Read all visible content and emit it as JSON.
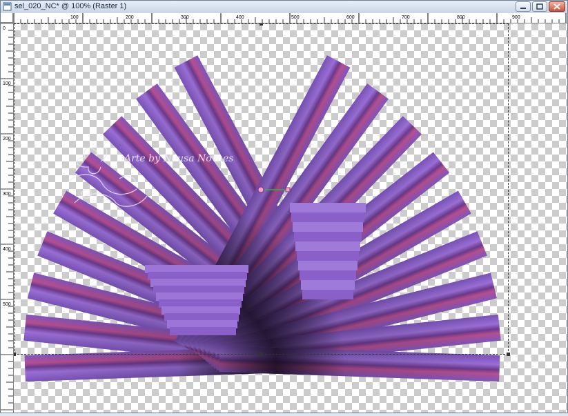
{
  "window": {
    "title": "sel_020_NC* @ 100% (Raster 1)",
    "buttons": [
      "minimize",
      "maximize",
      "close"
    ]
  },
  "ruler_top": {
    "labels": [
      "100",
      "200",
      "300",
      "400",
      "500",
      "600",
      "700",
      "800",
      "900"
    ]
  },
  "ruler_left": {
    "labels": [
      "0",
      "100",
      "200",
      "300",
      "400",
      "500"
    ]
  },
  "canvas": {
    "watermark_text": "Arte by Neusa Novaes",
    "accent_purple": "#8a5fc7",
    "accent_dark": "#1a0f22",
    "accent_pink": "#b64f8f"
  },
  "icons": {
    "app": "document-icon",
    "handle": "transform-handle-icon"
  }
}
